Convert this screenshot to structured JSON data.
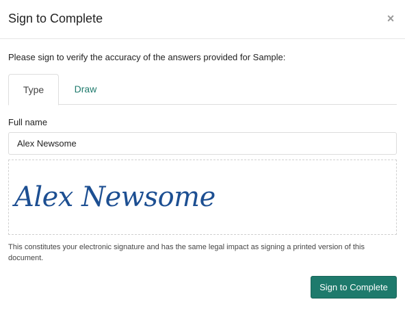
{
  "modal": {
    "title": "Sign to Complete",
    "close_glyph": "×",
    "close_icon": "close-icon"
  },
  "instructions": "Please sign to verify the accuracy of the answers provided for Sample:",
  "tabs": [
    {
      "label": "Type",
      "active": true
    },
    {
      "label": "Draw",
      "active": false
    }
  ],
  "full_name": {
    "label": "Full name",
    "value": "Alex Newsome"
  },
  "signature": {
    "text": "Alex Newsome"
  },
  "legal_text": "This constitutes your electronic signature and has the same legal impact as signing a printed version of this document.",
  "submit_label": "Sign to Complete",
  "colors": {
    "accent": "#1e7a6c",
    "signature_ink": "#1d4f92"
  }
}
